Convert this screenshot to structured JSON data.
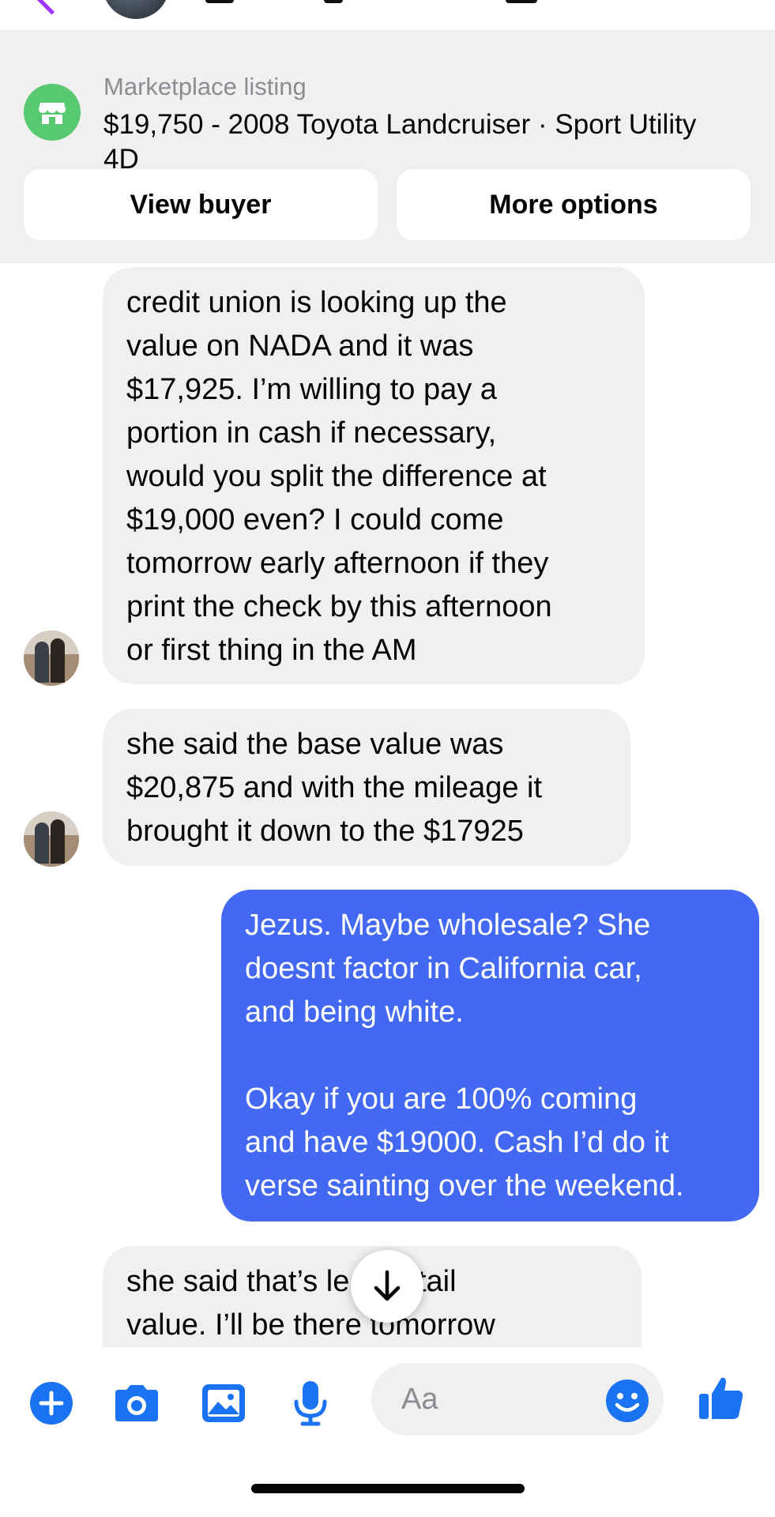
{
  "listing": {
    "label": "Marketplace listing",
    "title": "$19,750 - 2008 Toyota Landcruiser · Sport Utility 4D",
    "view_buyer": "View buyer",
    "more_options": "More options"
  },
  "messages": [
    {
      "direction": "incoming",
      "text": "credit union is looking up the\nvalue on NADA and it was\n$17,925. I’m willing to pay a\nportion in cash if necessary,\nwould you split the difference at\n$19,000 even? I could come\ntomorrow early afternoon if they\nprint the check by this afternoon\nor first thing in the AM"
    },
    {
      "direction": "incoming",
      "text": "she said the base value was\n$20,875 and with the mileage it\nbrought it down to the $17925"
    },
    {
      "direction": "outgoing",
      "text": "Jezus. Maybe wholesale? She\ndoesnt factor in California car,\nand being white.\n\nOkay if you are 100% coming\nand have $19000. Cash I’d do it\nverse sainting over the weekend."
    },
    {
      "direction": "incoming",
      "text": "she said that’s       lean retail\nvalue. I’ll be there tomorrow"
    }
  ],
  "composer": {
    "placeholder": "Aa",
    "icons": [
      "plus-icon",
      "camera-icon",
      "image-icon",
      "microphone-icon",
      "emoji-icon",
      "thumbs-up-icon"
    ]
  },
  "colors": {
    "accent": "#4369f2",
    "icon_blue": "#1a73f2",
    "incoming_bubble": "#f0f0f0",
    "marketplace_green": "#58c971",
    "back_purple": "#a033ff"
  }
}
